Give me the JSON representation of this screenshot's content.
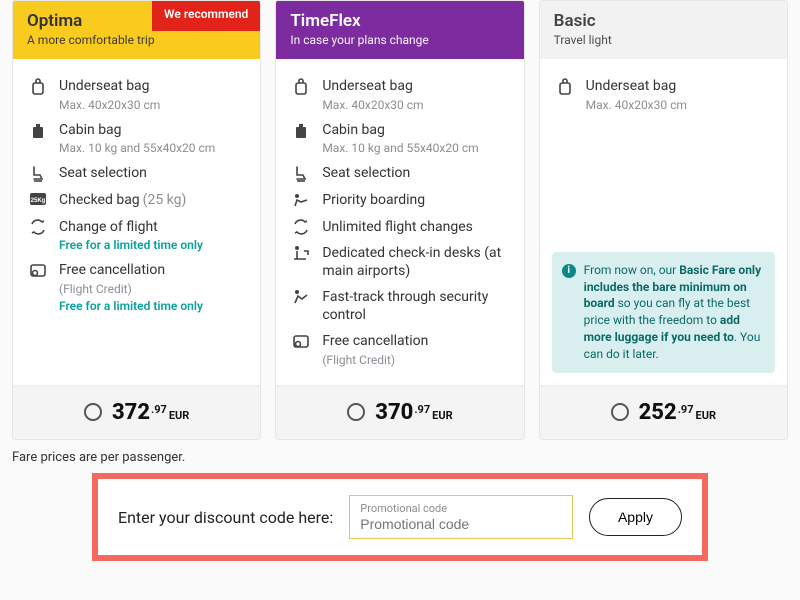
{
  "cards": [
    {
      "id": "optima",
      "headClass": "yellow",
      "title": "Optima",
      "subtitle": "A more comfortable trip",
      "ribbon": "We recommend",
      "price_whole": "372",
      "price_dec": ".97",
      "currency": "EUR",
      "features": [
        {
          "icon": "bag-underseat-icon",
          "main": "Underseat bag",
          "muted": "Max. 40x20x30 cm"
        },
        {
          "icon": "bag-cabin-icon",
          "main": "Cabin bag",
          "muted": "Max. 10 kg and 55x40x20 cm"
        },
        {
          "icon": "seat-icon",
          "main": "Seat selection"
        },
        {
          "icon": "bag-checked-icon",
          "main": "Checked bag",
          "inlineMuted": "(25 kg)"
        },
        {
          "icon": "change-icon",
          "main": "Change of flight",
          "promo": "Free for a limited time only"
        },
        {
          "icon": "cancel-icon",
          "main": "Free cancellation",
          "muted": "(Flight Credit)",
          "promo": "Free for a limited time only"
        }
      ]
    },
    {
      "id": "timeflex",
      "headClass": "purple",
      "title": "TimeFlex",
      "subtitle": "In case your plans change",
      "price_whole": "370",
      "price_dec": ".97",
      "currency": "EUR",
      "features": [
        {
          "icon": "bag-underseat-icon",
          "main": "Underseat bag",
          "muted": "Max. 40x20x30 cm"
        },
        {
          "icon": "bag-cabin-icon",
          "main": "Cabin bag",
          "muted": "Max. 10 kg and 55x40x20 cm"
        },
        {
          "icon": "seat-icon",
          "main": "Seat selection"
        },
        {
          "icon": "priority-icon",
          "main": "Priority boarding"
        },
        {
          "icon": "change-icon",
          "main": "Unlimited flight changes"
        },
        {
          "icon": "desk-icon",
          "main": "Dedicated check-in desks (at main airports)"
        },
        {
          "icon": "fasttrack-icon",
          "main": "Fast-track through security control"
        },
        {
          "icon": "cancel-icon",
          "main": "Free cancellation",
          "muted": "(Flight Credit)"
        }
      ]
    },
    {
      "id": "basic",
      "headClass": "grey",
      "title": "Basic",
      "subtitle": "Travel light",
      "price_whole": "252",
      "price_dec": ".97",
      "currency": "EUR",
      "features": [
        {
          "icon": "bag-underseat-icon",
          "main": "Underseat bag",
          "muted": "Max. 40x20x30 cm"
        }
      ],
      "notice_parts": {
        "a": "From now on, our ",
        "b1": "Basic Fare only includes the bare minimum on board",
        "c": " so you can fly at the best price with the freedom to ",
        "b2": "add more luggage if you need to",
        "d": ". You can do it later."
      }
    }
  ],
  "footnote": "Fare prices are per passenger.",
  "promo": {
    "label": "Enter your discount code here:",
    "placeholder": "Promotional code",
    "apply": "Apply"
  }
}
